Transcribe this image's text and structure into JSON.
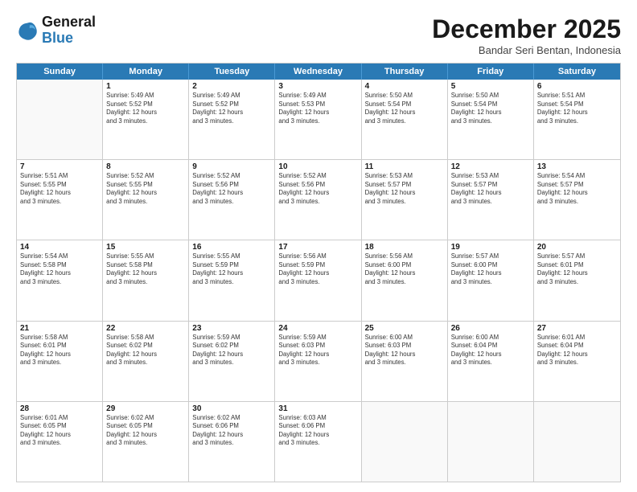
{
  "logo": {
    "line1": "General",
    "line2": "Blue"
  },
  "header": {
    "month": "December 2025",
    "location": "Bandar Seri Bentan, Indonesia"
  },
  "days": [
    "Sunday",
    "Monday",
    "Tuesday",
    "Wednesday",
    "Thursday",
    "Friday",
    "Saturday"
  ],
  "rows": [
    [
      {
        "date": "",
        "info": ""
      },
      {
        "date": "1",
        "info": "Sunrise: 5:49 AM\nSunset: 5:52 PM\nDaylight: 12 hours\nand 3 minutes."
      },
      {
        "date": "2",
        "info": "Sunrise: 5:49 AM\nSunset: 5:52 PM\nDaylight: 12 hours\nand 3 minutes."
      },
      {
        "date": "3",
        "info": "Sunrise: 5:49 AM\nSunset: 5:53 PM\nDaylight: 12 hours\nand 3 minutes."
      },
      {
        "date": "4",
        "info": "Sunrise: 5:50 AM\nSunset: 5:54 PM\nDaylight: 12 hours\nand 3 minutes."
      },
      {
        "date": "5",
        "info": "Sunrise: 5:50 AM\nSunset: 5:54 PM\nDaylight: 12 hours\nand 3 minutes."
      },
      {
        "date": "6",
        "info": "Sunrise: 5:51 AM\nSunset: 5:54 PM\nDaylight: 12 hours\nand 3 minutes."
      }
    ],
    [
      {
        "date": "7",
        "info": "Sunrise: 5:51 AM\nSunset: 5:55 PM\nDaylight: 12 hours\nand 3 minutes."
      },
      {
        "date": "8",
        "info": "Sunrise: 5:52 AM\nSunset: 5:55 PM\nDaylight: 12 hours\nand 3 minutes."
      },
      {
        "date": "9",
        "info": "Sunrise: 5:52 AM\nSunset: 5:56 PM\nDaylight: 12 hours\nand 3 minutes."
      },
      {
        "date": "10",
        "info": "Sunrise: 5:52 AM\nSunset: 5:56 PM\nDaylight: 12 hours\nand 3 minutes."
      },
      {
        "date": "11",
        "info": "Sunrise: 5:53 AM\nSunset: 5:57 PM\nDaylight: 12 hours\nand 3 minutes."
      },
      {
        "date": "12",
        "info": "Sunrise: 5:53 AM\nSunset: 5:57 PM\nDaylight: 12 hours\nand 3 minutes."
      },
      {
        "date": "13",
        "info": "Sunrise: 5:54 AM\nSunset: 5:57 PM\nDaylight: 12 hours\nand 3 minutes."
      }
    ],
    [
      {
        "date": "14",
        "info": "Sunrise: 5:54 AM\nSunset: 5:58 PM\nDaylight: 12 hours\nand 3 minutes."
      },
      {
        "date": "15",
        "info": "Sunrise: 5:55 AM\nSunset: 5:58 PM\nDaylight: 12 hours\nand 3 minutes."
      },
      {
        "date": "16",
        "info": "Sunrise: 5:55 AM\nSunset: 5:59 PM\nDaylight: 12 hours\nand 3 minutes."
      },
      {
        "date": "17",
        "info": "Sunrise: 5:56 AM\nSunset: 5:59 PM\nDaylight: 12 hours\nand 3 minutes."
      },
      {
        "date": "18",
        "info": "Sunrise: 5:56 AM\nSunset: 6:00 PM\nDaylight: 12 hours\nand 3 minutes."
      },
      {
        "date": "19",
        "info": "Sunrise: 5:57 AM\nSunset: 6:00 PM\nDaylight: 12 hours\nand 3 minutes."
      },
      {
        "date": "20",
        "info": "Sunrise: 5:57 AM\nSunset: 6:01 PM\nDaylight: 12 hours\nand 3 minutes."
      }
    ],
    [
      {
        "date": "21",
        "info": "Sunrise: 5:58 AM\nSunset: 6:01 PM\nDaylight: 12 hours\nand 3 minutes."
      },
      {
        "date": "22",
        "info": "Sunrise: 5:58 AM\nSunset: 6:02 PM\nDaylight: 12 hours\nand 3 minutes."
      },
      {
        "date": "23",
        "info": "Sunrise: 5:59 AM\nSunset: 6:02 PM\nDaylight: 12 hours\nand 3 minutes."
      },
      {
        "date": "24",
        "info": "Sunrise: 5:59 AM\nSunset: 6:03 PM\nDaylight: 12 hours\nand 3 minutes."
      },
      {
        "date": "25",
        "info": "Sunrise: 6:00 AM\nSunset: 6:03 PM\nDaylight: 12 hours\nand 3 minutes."
      },
      {
        "date": "26",
        "info": "Sunrise: 6:00 AM\nSunset: 6:04 PM\nDaylight: 12 hours\nand 3 minutes."
      },
      {
        "date": "27",
        "info": "Sunrise: 6:01 AM\nSunset: 6:04 PM\nDaylight: 12 hours\nand 3 minutes."
      }
    ],
    [
      {
        "date": "28",
        "info": "Sunrise: 6:01 AM\nSunset: 6:05 PM\nDaylight: 12 hours\nand 3 minutes."
      },
      {
        "date": "29",
        "info": "Sunrise: 6:02 AM\nSunset: 6:05 PM\nDaylight: 12 hours\nand 3 minutes."
      },
      {
        "date": "30",
        "info": "Sunrise: 6:02 AM\nSunset: 6:06 PM\nDaylight: 12 hours\nand 3 minutes."
      },
      {
        "date": "31",
        "info": "Sunrise: 6:03 AM\nSunset: 6:06 PM\nDaylight: 12 hours\nand 3 minutes."
      },
      {
        "date": "",
        "info": ""
      },
      {
        "date": "",
        "info": ""
      },
      {
        "date": "",
        "info": ""
      }
    ]
  ]
}
